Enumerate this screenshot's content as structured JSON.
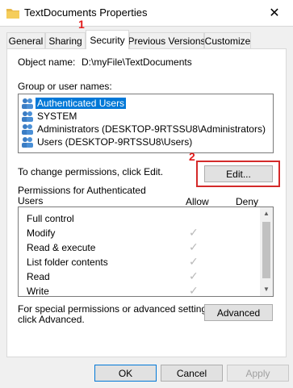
{
  "window": {
    "title": "TextDocuments Properties",
    "close_glyph": "✕"
  },
  "tabs": [
    {
      "label": "General"
    },
    {
      "label": "Sharing"
    },
    {
      "label": "Security"
    },
    {
      "label": "Previous Versions"
    },
    {
      "label": "Customize"
    }
  ],
  "security": {
    "object_name_label": "Object name:",
    "object_name_value": "D:\\myFile\\TextDocuments",
    "group_label": "Group or user names:",
    "users": [
      {
        "name": "Authenticated Users",
        "selected": true
      },
      {
        "name": "SYSTEM",
        "selected": false
      },
      {
        "name": "Administrators (DESKTOP-9RTSSU8\\Administrators)",
        "selected": false
      },
      {
        "name": "Users (DESKTOP-9RTSSU8\\Users)",
        "selected": false
      }
    ],
    "change_text": "To change permissions, click Edit.",
    "edit_label": "Edit...",
    "permissions_title_line1": "Permissions for Authenticated",
    "permissions_title_line2": "Users",
    "allow_header": "Allow",
    "deny_header": "Deny",
    "permissions": [
      {
        "name": "Full control",
        "allow": false,
        "deny": false
      },
      {
        "name": "Modify",
        "allow": true,
        "deny": false
      },
      {
        "name": "Read & execute",
        "allow": true,
        "deny": false
      },
      {
        "name": "List folder contents",
        "allow": true,
        "deny": false
      },
      {
        "name": "Read",
        "allow": true,
        "deny": false
      },
      {
        "name": "Write",
        "allow": true,
        "deny": false
      }
    ],
    "advanced_text_line1": "For special permissions or advanced settings,",
    "advanced_text_line2": "click Advanced.",
    "advanced_label": "Advanced"
  },
  "footer": {
    "ok": "OK",
    "cancel": "Cancel",
    "apply": "Apply"
  },
  "annotations": {
    "step1": "1",
    "step2": "2",
    "color": "#e21a1a"
  },
  "icons": {
    "folder": "folder-icon",
    "users": "user-group-icon",
    "check": "checkmark-icon"
  }
}
